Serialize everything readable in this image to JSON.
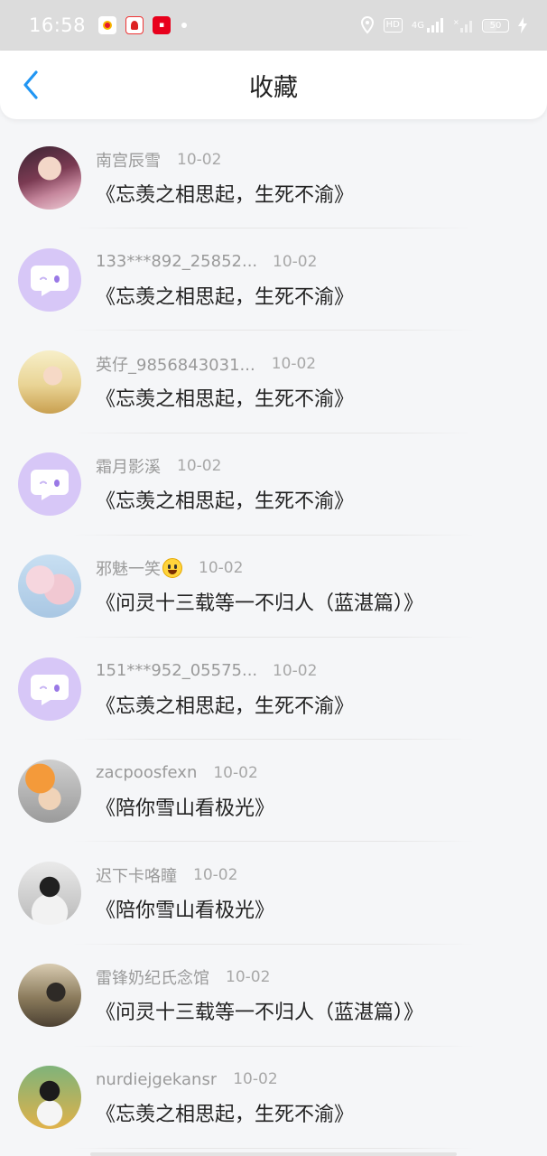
{
  "status_bar": {
    "time": "16:58",
    "app_icons": [
      "weibo-icon",
      "red-icon",
      "tmall-icon"
    ],
    "network": "4G",
    "hd_label": "HD",
    "battery": "50"
  },
  "header": {
    "title": "收藏",
    "back_icon": "chevron-left-icon"
  },
  "list": [
    {
      "name": "南宫辰雪",
      "date": "10-02",
      "book": "《忘羡之相思起，生死不渝》",
      "avatar": "photo1"
    },
    {
      "name": "133***892_25852...",
      "date": "10-02",
      "book": "《忘羡之相思起，生死不渝》",
      "avatar": "default"
    },
    {
      "name": "英仔_9856843031...",
      "date": "10-02",
      "book": "《忘羡之相思起，生死不渝》",
      "avatar": "photo2"
    },
    {
      "name": "霜月影溪",
      "date": "10-02",
      "book": "《忘羡之相思起，生死不渝》",
      "avatar": "default"
    },
    {
      "name": "邪魅一笑",
      "date": "10-02",
      "book": "《问灵十三载等一不归人（蓝湛篇）》",
      "avatar": "photo3",
      "emoji": "grin-emoji"
    },
    {
      "name": "151***952_05575...",
      "date": "10-02",
      "book": "《忘羡之相思起，生死不渝》",
      "avatar": "default"
    },
    {
      "name": "zacpoosfexn",
      "date": "10-02",
      "book": "《陪你雪山看极光》",
      "avatar": "photo4"
    },
    {
      "name": "迟下卡咯瞳",
      "date": "10-02",
      "book": "《陪你雪山看极光》",
      "avatar": "photo5"
    },
    {
      "name": "雷锋奶纪氏念馆",
      "date": "10-02",
      "book": "《问灵十三载等一不归人（蓝湛篇）》",
      "avatar": "photo6"
    },
    {
      "name": "nurdiejgekansr",
      "date": "10-02",
      "book": "《忘羡之相思起，生死不渝》",
      "avatar": "photo7"
    }
  ],
  "colors": {
    "accent": "#2196f3",
    "default_avatar": "#d7c7f7",
    "meta_text": "#9a9a9a"
  }
}
